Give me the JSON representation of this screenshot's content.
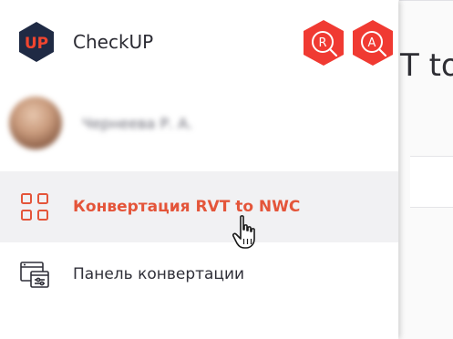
{
  "app": {
    "name": "CheckUP",
    "logo_text": "UP"
  },
  "roles": [
    {
      "letter": "R"
    },
    {
      "letter": "A"
    }
  ],
  "user": {
    "name": "Чернеева Р. А."
  },
  "menu": {
    "items": [
      {
        "label": "Конвертация RVT to NWC",
        "icon": "grid-icon",
        "active": true
      },
      {
        "label": "Панель конвертации",
        "icon": "panel-settings-icon",
        "active": false
      }
    ]
  },
  "background_page": {
    "title_fragment": "T to"
  },
  "colors": {
    "accent": "#e4553a",
    "badge": "#f03a32",
    "logo_bg": "#1f2a44",
    "active_bg": "#f1f1f3"
  }
}
